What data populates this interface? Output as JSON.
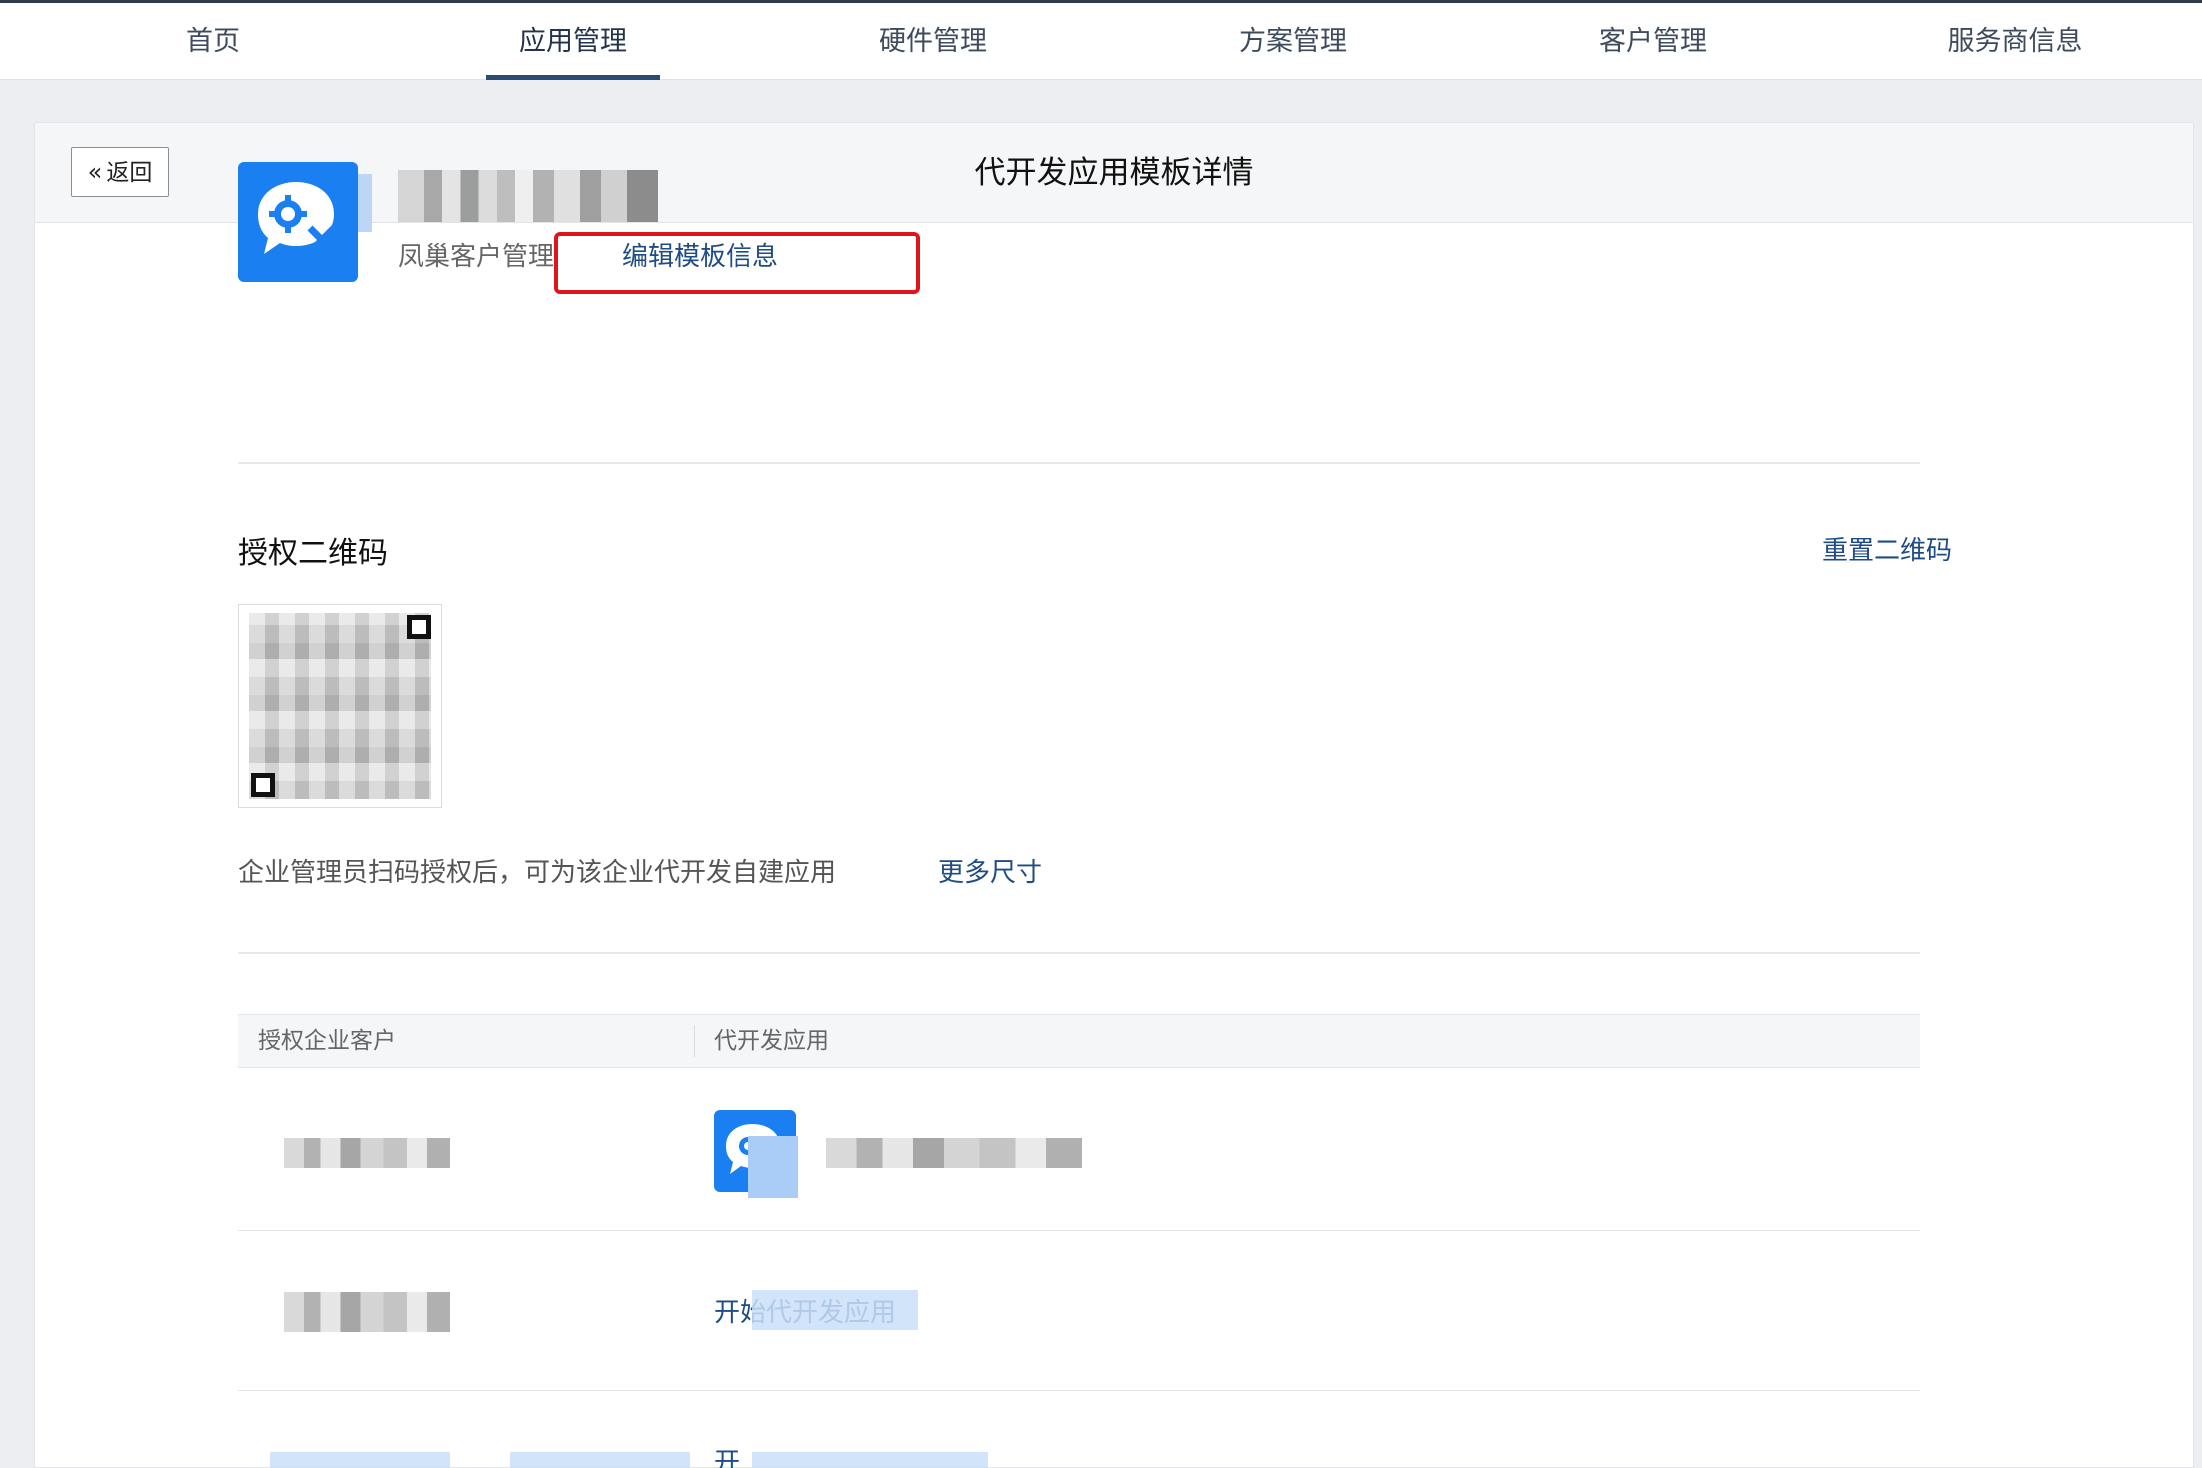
{
  "nav": {
    "items": [
      {
        "label": "首页"
      },
      {
        "label": "应用管理"
      },
      {
        "label": "硬件管理"
      },
      {
        "label": "方案管理"
      },
      {
        "label": "客户管理"
      },
      {
        "label": "服务商信息"
      }
    ],
    "active_index": 1
  },
  "header": {
    "back_label": "返回",
    "title": "代开发应用模板详情"
  },
  "app": {
    "subtitle": "凤巢客户管理",
    "edit_link": "编辑模板信息"
  },
  "qr_section": {
    "title": "授权二维码",
    "reset_link": "重置二维码",
    "note": "企业管理员扫码授权后，可为该企业代开发自建应用",
    "more_link": "更多尺寸"
  },
  "table": {
    "columns": [
      "授权企业客户",
      "代开发应用"
    ],
    "rows": [
      {
        "app_action": ""
      },
      {
        "app_action": "开始代开发应用"
      },
      {
        "app_action": "开"
      }
    ]
  },
  "colors": {
    "accent": "#1f4c86",
    "app_icon": "#1a7ff0",
    "highlight_box": "#e0141b"
  }
}
